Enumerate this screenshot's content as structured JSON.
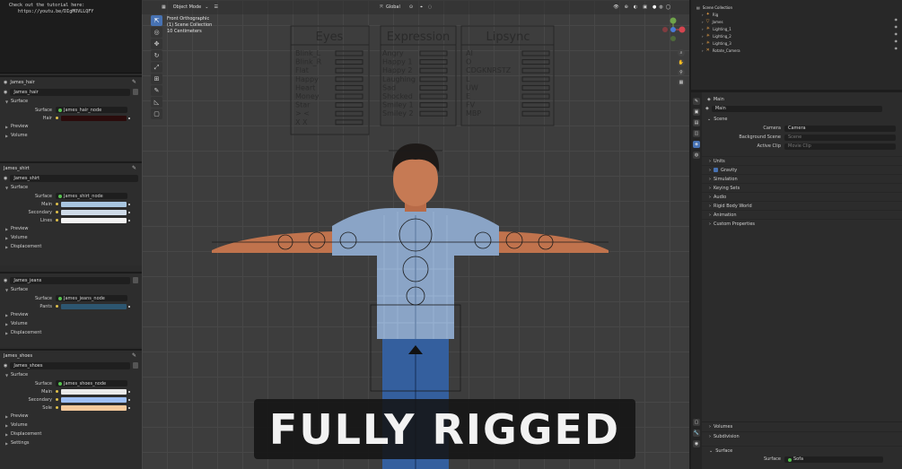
{
  "note": {
    "line1": "Check out the tutorial here:",
    "line2": "https://youtu.be/DIgMOVLLQFY"
  },
  "materials": [
    {
      "header": "James_hair",
      "slot": "James_hair",
      "props": [
        {
          "label": "Surface",
          "node": "James_hair_node"
        }
      ],
      "colors": [
        {
          "label": "Hair",
          "color": "#2a0c0c"
        }
      ],
      "sections": [
        "Preview",
        "Volume"
      ]
    },
    {
      "header": "James_shirt",
      "slot": "James_shirt",
      "props": [
        {
          "label": "Surface",
          "node": "James_shirt_node"
        }
      ],
      "colors": [
        {
          "label": "Main",
          "color": "#a9c6e0"
        },
        {
          "label": "Secondary",
          "color": "#cfdbe8"
        },
        {
          "label": "Lines",
          "color": "#f2f2f2"
        }
      ],
      "sections": [
        "Preview",
        "Volume",
        "Displacement"
      ]
    },
    {
      "header": "James_jeans",
      "slot": "James_jeans",
      "props": [
        {
          "label": "Surface",
          "node": "James_jeans_node"
        }
      ],
      "colors": [
        {
          "label": "Pants",
          "color": "#2d5670"
        }
      ],
      "sections": [
        "Preview",
        "Volume",
        "Displacement"
      ]
    },
    {
      "header": "James_shoes",
      "slot": "James_shoes",
      "props": [
        {
          "label": "Surface",
          "node": "James_shoes_node"
        }
      ],
      "colors": [
        {
          "label": "Main",
          "color": "#e9e9e9"
        },
        {
          "label": "Secondary",
          "color": "#9fbff5"
        },
        {
          "label": "Sole",
          "color": "#f6c99b"
        }
      ],
      "sections": [
        "Preview",
        "Volume",
        "Displacement",
        "Settings"
      ]
    }
  ],
  "surface_label": "Surface",
  "viewport": {
    "mode": "Object Mode",
    "orientation": "Global",
    "view_name": "Front Orthographic",
    "collection": "(1) Scene Collection",
    "scale": "10 Centimeters"
  },
  "rig_panels": {
    "eyes": {
      "title": "Eyes",
      "rows": [
        "Blink_L",
        "Blink_R",
        "Flat",
        "Happy",
        "Heart",
        "Money",
        "Star",
        "> <",
        "X X"
      ]
    },
    "expression": {
      "title": "Expression",
      "rows": [
        "Angry",
        "Happy 1",
        "Happy 2",
        "Laughing",
        "Sad",
        "Shocked",
        "Smiley 1",
        "Smiley 2"
      ]
    },
    "lipsync": {
      "title": "Lipsync",
      "rows": [
        "AI",
        "O",
        "CDGKNRSTZ",
        "L",
        "UW",
        "E",
        "FV",
        "MBP"
      ]
    }
  },
  "banner": "FULLY RIGGED",
  "outliner": {
    "title": "Scene Collection",
    "items": [
      "Rig",
      "James",
      "Lighting_1",
      "Lighting_2",
      "Lighting_3",
      "Rotate_Camera"
    ]
  },
  "properties": {
    "header": "Main",
    "scene_label": "Scene",
    "camera_label": "Camera",
    "camera_value": "Camera",
    "bg_label": "Background Scene",
    "bg_value": "Scene",
    "clip_label": "Active Clip",
    "clip_value": "Movie Clip",
    "sections": [
      "Units",
      "Gravity",
      "Simulation",
      "Keying Sets",
      "Audio",
      "Rigid Body World",
      "Animation",
      "Custom Properties"
    ],
    "lower_sections": [
      "Volumes",
      "Subdivision"
    ],
    "lower_surface_head": "Surface",
    "lower_surface_label": "Surface",
    "lower_surface_value": "Sofa"
  },
  "colors": {
    "accent": "#4772b3",
    "node_green": "#56c24f",
    "viewport_bg": "#3d3d3d"
  }
}
